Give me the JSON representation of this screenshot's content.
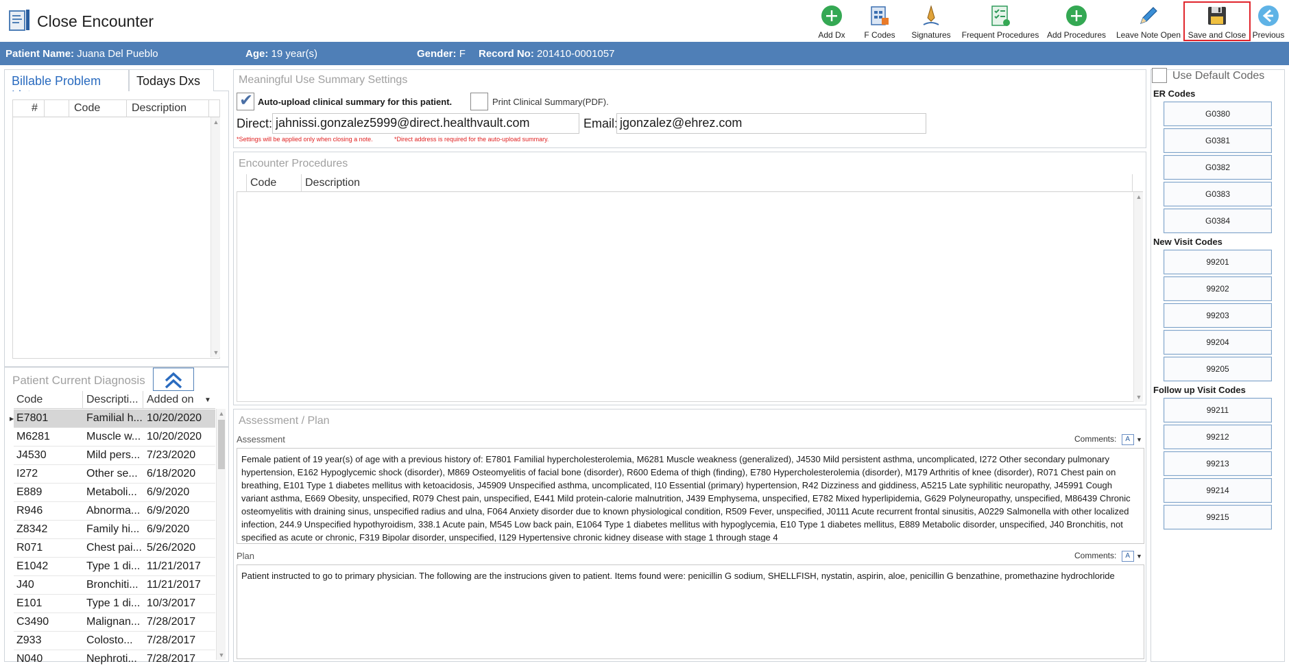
{
  "window": {
    "title": "Close Encounter"
  },
  "toolbar": [
    {
      "label": "Add Dx",
      "icon": "add-circle-icon"
    },
    {
      "label": "F Codes",
      "icon": "f-codes-icon"
    },
    {
      "label": "Signatures",
      "icon": "signature-pen-icon"
    },
    {
      "label": "Frequent Procedures",
      "icon": "checklist-icon"
    },
    {
      "label": "Add Procedures",
      "icon": "add-circle-icon"
    },
    {
      "label": "Leave Note Open",
      "icon": "pencil-icon"
    },
    {
      "label": "Save and Close",
      "icon": "floppy-disk-icon",
      "highlighted": true
    },
    {
      "label": "Previous",
      "icon": "arrow-left-circle-icon"
    }
  ],
  "patient": {
    "name_label": "Patient Name:",
    "name": "Juana Del Pueblo",
    "age_label": "Age:",
    "age": "19 year(s)",
    "gender_label": "Gender:",
    "gender": "F",
    "record_label": "Record No:",
    "record": "201410-0001057"
  },
  "left_tabs": [
    "Billable Problem List",
    "Todays Dxs"
  ],
  "problem_list": {
    "columns": [
      "#",
      "Code",
      "Description"
    ]
  },
  "diagnosis": {
    "title": "Patient Current Diagnosis",
    "columns": [
      "Code",
      "Descripti...",
      "Added on"
    ],
    "rows": [
      {
        "code": "E7801",
        "desc": "Familial h...",
        "date": "10/20/2020"
      },
      {
        "code": "M6281",
        "desc": "Muscle w...",
        "date": "10/20/2020"
      },
      {
        "code": "J4530",
        "desc": "Mild pers...",
        "date": "7/23/2020"
      },
      {
        "code": "I272",
        "desc": "Other se...",
        "date": "6/18/2020"
      },
      {
        "code": "E889",
        "desc": "Metaboli...",
        "date": "6/9/2020"
      },
      {
        "code": "R946",
        "desc": "Abnorma...",
        "date": "6/9/2020"
      },
      {
        "code": "Z8342",
        "desc": "Family hi...",
        "date": "6/9/2020"
      },
      {
        "code": "R071",
        "desc": "Chest pai...",
        "date": "5/26/2020"
      },
      {
        "code": "E1042",
        "desc": "Type 1 di...",
        "date": "11/21/2017"
      },
      {
        "code": "J40",
        "desc": "Bronchiti...",
        "date": "11/21/2017"
      },
      {
        "code": "E101",
        "desc": "Type 1 di...",
        "date": "10/3/2017"
      },
      {
        "code": "C3490",
        "desc": "Malignan...",
        "date": "7/28/2017"
      },
      {
        "code": "Z933",
        "desc": "Colosto...",
        "date": "7/28/2017"
      },
      {
        "code": "N040",
        "desc": "Nephroti...",
        "date": "7/28/2017"
      }
    ]
  },
  "mu": {
    "title": "Meaningful Use Summary Settings",
    "auto_upload_label": "Auto-upload clinical summary for this patient.",
    "print_label": "Print Clinical Summary(PDF).",
    "direct_label": "Direct:",
    "direct_value": "jahnissi.gonzalez5999@direct.healthvault.com",
    "email_label": "Email:",
    "email_value": "jgonzalez@ehrez.com",
    "note1": "*Settings will be applied only when closing a note.",
    "note2": "*Direct address is required for the auto-upload summary."
  },
  "procedures": {
    "title": "Encounter Procedures",
    "columns": [
      "Code",
      "Description"
    ]
  },
  "assessment": {
    "title": "Assessment / Plan",
    "assessment_label": "Assessment",
    "plan_label": "Plan",
    "comments_label": "Comments:",
    "assessment_text": "Female patient of 19 year(s) of age  with a previous history of: E7801 Familial hypercholesterolemia, M6281 Muscle weakness (generalized), J4530 Mild persistent asthma, uncomplicated, I272 Other secondary pulmonary hypertension, E162 Hypoglycemic shock (disorder), M869 Osteomyelitis of facial bone (disorder), R600 Edema of thigh (finding), E780 Hypercholesterolemia (disorder), M179 Arthritis of knee (disorder), R071 Chest pain on breathing, E101 Type 1 diabetes mellitus with ketoacidosis, J45909 Unspecified asthma, uncomplicated, I10 Essential (primary) hypertension, R42 Dizziness and giddiness, A5215 Late syphilitic neuropathy, J45991 Cough variant asthma, E669 Obesity, unspecified, R079 Chest pain, unspecified, E441 Mild protein-calorie malnutrition, J439 Emphysema, unspecified, E782 Mixed hyperlipidemia, G629 Polyneuropathy, unspecified, M86439 Chronic osteomyelitis with draining sinus, unspecified radius and ulna, F064 Anxiety disorder due to known physiological condition, R509 Fever, unspecified, J0111 Acute recurrent frontal sinusitis, A0229 Salmonella with other localized infection, 244.9 Unspecified hypothyroidism, 338.1 Acute pain, M545 Low back pain, E1064 Type 1 diabetes mellitus with hypoglycemia, E10 Type 1 diabetes mellitus, E889 Metabolic disorder, unspecified, J40 Bronchitis, not specified as acute or chronic, F319 Bipolar disorder, unspecified, I129 Hypertensive chronic kidney disease with stage 1 through stage 4",
    "plan_text": "    Patient instructed to go to primary physician.  The following are the instrucions given to patient.     Items found were:  penicillin G sodium, SHELLFISH, nystatin, aspirin, aloe, penicillin G benzathine, promethazine hydrochloride"
  },
  "codes": {
    "use_default_label": "Use Default Codes",
    "er_title": "ER Codes",
    "er": [
      "G0380",
      "G0381",
      "G0382",
      "G0383",
      "G0384"
    ],
    "new_title": "New Visit Codes",
    "new": [
      "99201",
      "99202",
      "99203",
      "99204",
      "99205"
    ],
    "follow_title": "Follow up Visit Codes",
    "follow": [
      "99211",
      "99212",
      "99213",
      "99214",
      "99215"
    ]
  }
}
